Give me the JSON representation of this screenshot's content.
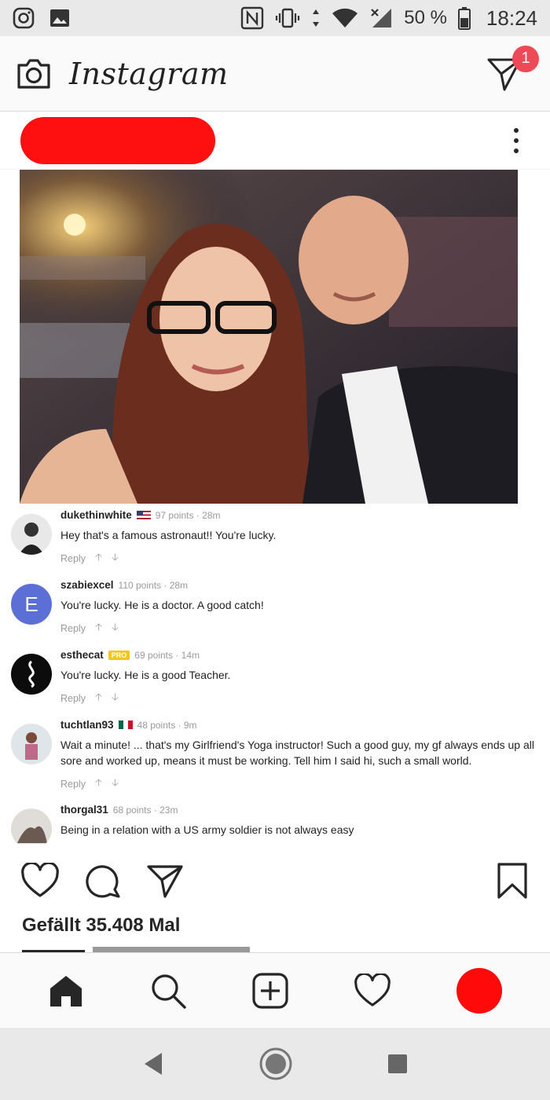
{
  "status_bar": {
    "battery": "50 %",
    "time": "18:24"
  },
  "app": {
    "name": "Instagram",
    "notification_count": "1"
  },
  "post": {
    "likes_text": "Gefällt 35.408 Mal"
  },
  "comments": [
    {
      "user": "dukethinwhite",
      "meta": "97 points · 28m",
      "text": "Hey that's a famous astronaut!! You're lucky.",
      "reply": "Reply"
    },
    {
      "user": "szabiexcel",
      "meta": "110 points · 28m",
      "text": "You're lucky. He is a doctor. A good catch!",
      "reply": "Reply",
      "avatar_letter": "E"
    },
    {
      "user": "esthecat",
      "badge": "PRO",
      "meta": "69 points · 14m",
      "text": "You're lucky. He is a good Teacher.",
      "reply": "Reply"
    },
    {
      "user": "tuchtlan93",
      "meta": "48 points · 9m",
      "text": "Wait a minute! ... that's my Girlfriend's Yoga instructor! Such a good guy, my gf always ends up all sore and worked up, means it must be working. Tell him I said hi, such a small world.",
      "reply": "Reply"
    },
    {
      "user": "thorgal31",
      "meta": "68 points · 23m",
      "text": "Being in a relation with a US army soldier is not always easy"
    }
  ],
  "colors": {
    "accent_red": "#ed4956",
    "redaction": "#ff1010"
  }
}
